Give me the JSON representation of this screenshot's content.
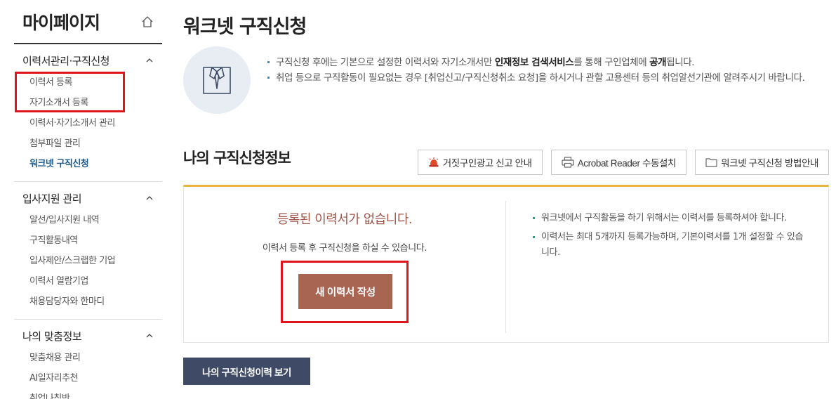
{
  "sidebar": {
    "title": "마이페이지",
    "home_icon": "home-icon",
    "groups": [
      {
        "title": "이력서관리·구직신청",
        "items": [
          {
            "label": "이력서 등록"
          },
          {
            "label": "자기소개서 등록"
          },
          {
            "label": "이력서·자기소개서 관리"
          },
          {
            "label": "첨부파일 관리"
          },
          {
            "label": "워크넷 구직신청"
          }
        ]
      },
      {
        "title": "입사지원 관리",
        "items": [
          {
            "label": "알선/입사지원 내역"
          },
          {
            "label": "구직활동내역"
          },
          {
            "label": "입사제안/스크랩한 기업"
          },
          {
            "label": "이력서 열람기업"
          },
          {
            "label": "채용담당자와 한마디"
          }
        ]
      },
      {
        "title": "나의 맞춤정보",
        "items": [
          {
            "label": "맞춤채용 관리"
          },
          {
            "label": "AI일자리추천"
          },
          {
            "label": "취업나침반"
          }
        ]
      }
    ]
  },
  "main": {
    "title": "워크넷 구직신청",
    "info": {
      "line1_pre": "구직신청 후에는 기본으로 설정한 이력서와 자기소개서만 ",
      "line1_bold1": "인재정보 검색서비스",
      "line1_mid": "를 통해 구인업체에 ",
      "line1_bold2": "공개",
      "line1_post": "됩니다.",
      "line2": "취업 등으로 구직활동이 필요없는 경우 [취업신고/구직신청취소 요청]을 하시거나 관할 고용센터 등의 취업알선기관에 알려주시기 바랍니다."
    },
    "section_title": "나의 구직신청정보",
    "buttons": {
      "report": "거짓구인광고 신고 안내",
      "acrobat": "Acrobat Reader 수동설치",
      "guide": "워크넷 구직신청 방법안내"
    },
    "panel": {
      "empty_title": "등록된 이력서가 없습니다.",
      "empty_desc": "이력서 등록 후 구직신청을 하실 수 있습니다.",
      "new_button": "새 이력서 작성",
      "notes": [
        "워크넷에서 구직활동을 하기 위해서는 이력서를 등록하셔야 합니다.",
        "이력서는 최대 5개까지 등록가능하며, 기본이력서를 1개 설정할 수 있습니다."
      ]
    },
    "history_button": "나의 구직신청이력 보기"
  },
  "colors": {
    "accent_orange": "#e8b341",
    "new_button_bg": "#a86552",
    "history_button_bg": "#3f4a66",
    "highlight_red": "#e0141c",
    "active_link": "#1d5a8a"
  }
}
